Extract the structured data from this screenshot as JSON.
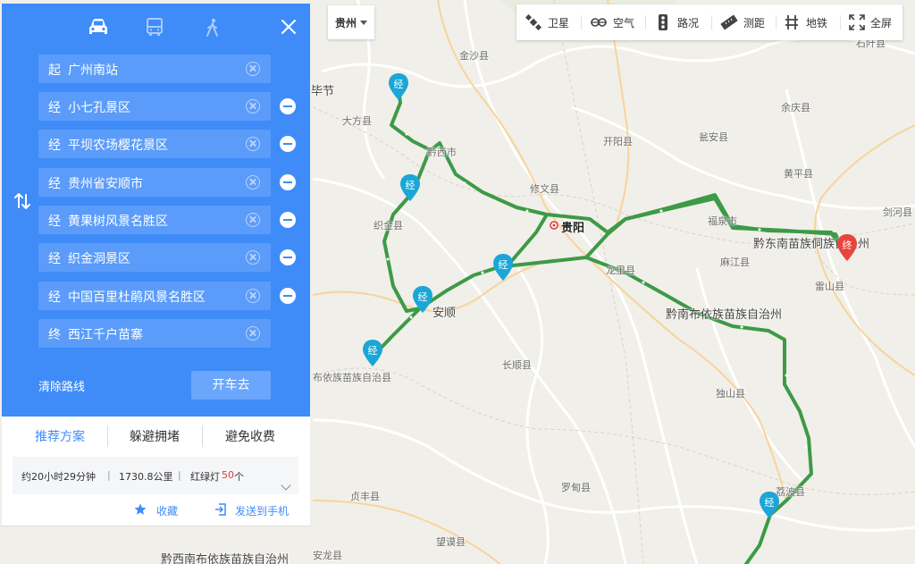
{
  "panel": {
    "modes": [
      {
        "name": "car-icon",
        "active": true
      },
      {
        "name": "bus-icon",
        "active": false
      },
      {
        "name": "walk-icon",
        "active": false
      }
    ],
    "waypoints": [
      {
        "tag": "起",
        "name": "广州南站",
        "removable": false
      },
      {
        "tag": "经",
        "name": "小七孔景区",
        "removable": true
      },
      {
        "tag": "经",
        "name": "平坝农场樱花景区",
        "removable": true
      },
      {
        "tag": "经",
        "name": "贵州省安顺市",
        "removable": true
      },
      {
        "tag": "经",
        "name": "黄果树风景名胜区",
        "removable": true
      },
      {
        "tag": "经",
        "name": "织金洞景区",
        "removable": true
      },
      {
        "tag": "经",
        "name": "中国百里杜鹃风景名胜区",
        "removable": true
      },
      {
        "tag": "终",
        "name": "西江千户苗寨",
        "removable": false
      }
    ],
    "clear_route": "清除路线",
    "go_button": "开车去"
  },
  "options": {
    "tabs": [
      "推荐方案",
      "躲避拥堵",
      "避免收费"
    ],
    "active_tab": 0,
    "summary": {
      "duration": "约20小时29分钟",
      "sep1": "|",
      "distance": "1730.8公里",
      "sep2": "|",
      "lights_label": "红绿灯",
      "lights_count": "50",
      "lights_unit": "个"
    },
    "favorite": "收藏",
    "send_to_phone": "发送到手机"
  },
  "city_selector": {
    "label": "贵州"
  },
  "toolbar": [
    {
      "label": "卫星",
      "icon": "satellite-icon"
    },
    {
      "label": "空气",
      "icon": "air-icon"
    },
    {
      "label": "路况",
      "icon": "traffic-light-icon"
    },
    {
      "label": "测距",
      "icon": "ruler-icon"
    },
    {
      "label": "地铁",
      "icon": "subway-icon"
    },
    {
      "label": "全屏",
      "icon": "fullscreen-icon"
    }
  ],
  "map": {
    "capital": "贵阳",
    "labels": [
      "金沙县",
      "毕节",
      "大方县",
      "黔西市",
      "开阳县",
      "瓮安县",
      "余庆县",
      "修文县",
      "黄平县",
      "剑河县",
      "石阡县",
      "织金县",
      "福泉市",
      "黔东南苗族侗族自治州",
      "麻江县",
      "雷山县",
      "龙里县",
      "安顺",
      "黔南布依族苗族自治州",
      "长顺县",
      "布依族苗族自治县",
      "独山县",
      "荔波县",
      "贞丰县",
      "罗甸县",
      "望谟县",
      "安龙县",
      "黔西南布依族苗族自治州"
    ],
    "via_marker_label": "经",
    "end_marker_label": "终",
    "route_color": "#3d9a47",
    "via_marker_color": "#1aa7d8",
    "end_marker_color": "#e8453c"
  }
}
